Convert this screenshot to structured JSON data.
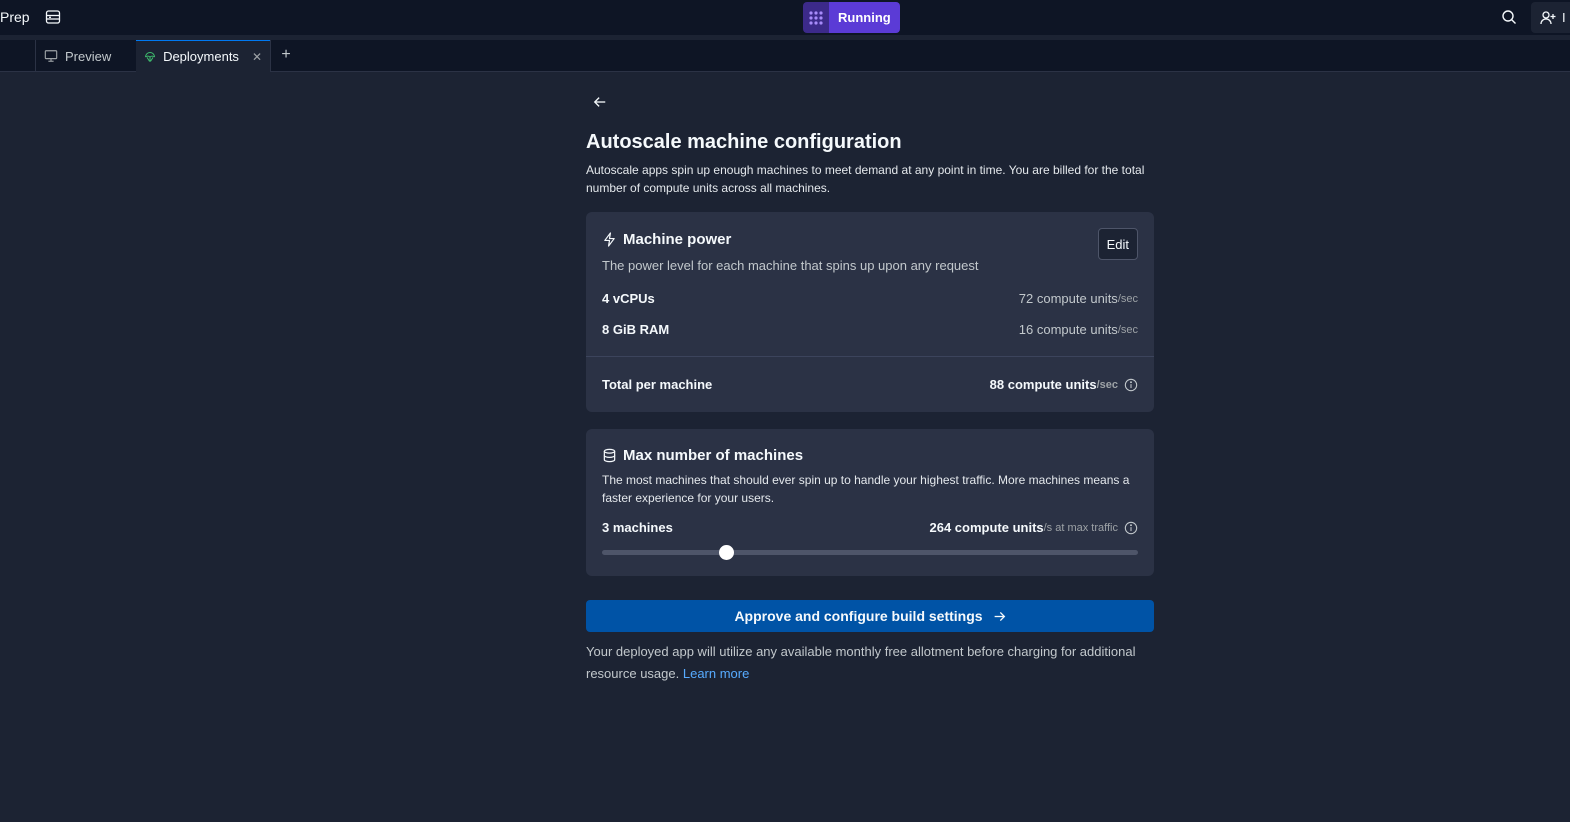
{
  "topbar": {
    "app_name": "Prep",
    "run_label": "Running",
    "invite_label": "I"
  },
  "tabs": [
    {
      "label": "Preview",
      "icon": "monitor-icon"
    },
    {
      "label": "Deployments",
      "icon": "deployments-icon",
      "active": true
    }
  ],
  "page": {
    "title": "Autoscale machine configuration",
    "description": "Autoscale apps spin up enough machines to meet demand at any point in time. You are billed for the total number of compute units across all machines."
  },
  "machine_power": {
    "title": "Machine power",
    "subtitle": "The power level for each machine that spins up upon any request",
    "edit_label": "Edit",
    "rows": [
      {
        "label": "4 vCPUs",
        "value": "72 compute units",
        "unit": "/sec"
      },
      {
        "label": "8 GiB RAM",
        "value": "16 compute units",
        "unit": "/sec"
      }
    ],
    "total": {
      "label": "Total per machine",
      "value": "88 compute units",
      "unit": "/sec"
    }
  },
  "max_machines": {
    "title": "Max number of machines",
    "description": "The most machines that should ever spin up to handle your highest traffic. More machines means a faster experience for your users.",
    "count_label": "3 machines",
    "value": "264 compute units",
    "unit": "/s at max traffic",
    "slider_fraction": 0.231
  },
  "approve_label": "Approve and configure build settings",
  "footnote": {
    "text": "Your deployed app will utilize any available monthly free allotment before charging for additional resource usage.",
    "link": "Learn more"
  },
  "colors": {
    "background": "#1c2333",
    "card": "#2b3245",
    "accent_purple": "#5b3bd6",
    "primary_blue": "#0053a6",
    "link": "#57abff"
  }
}
